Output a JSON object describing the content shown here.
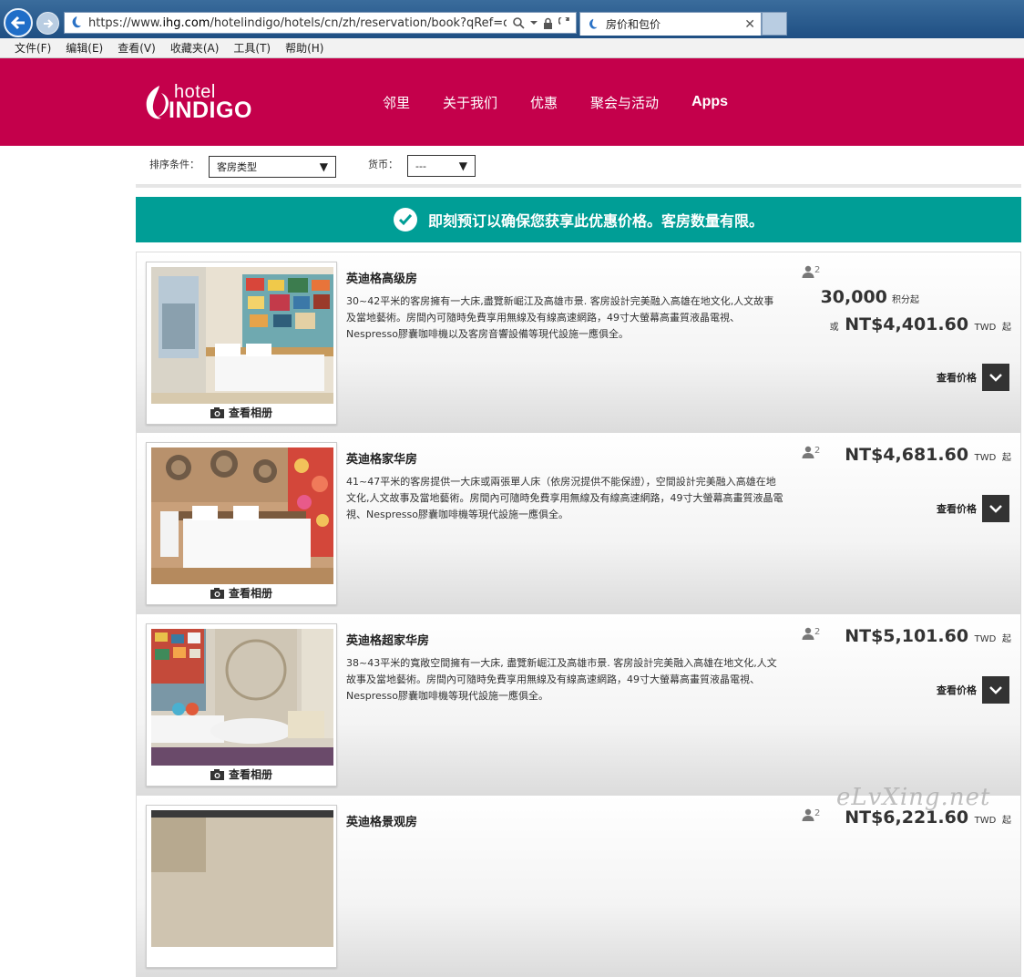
{
  "browser": {
    "url_prefix": "https://www.",
    "url_domain": "ihg.com",
    "url_rest": "/hotelindigo/hotels/cn/zh/reservation/book?qRef=df&qRpn",
    "tab_title": "房价和包价",
    "menu": [
      "文件(F)",
      "编辑(E)",
      "查看(V)",
      "收藏夹(A)",
      "工具(T)",
      "帮助(H)"
    ]
  },
  "header": {
    "logo_hotel": "hotel",
    "logo_indigo": "INDIGO",
    "nav": [
      "邻里",
      "关于我们",
      "优惠",
      "聚会与活动",
      "Apps"
    ]
  },
  "filters": {
    "sort_label": "排序条件：",
    "sort_value": "客房类型",
    "currency_label": "货币：",
    "currency_value": "---"
  },
  "promo": {
    "text": "即刻预订以确保您获享此优惠价格。客房数量有限。"
  },
  "album_label": "查看相册",
  "view_price_label": "查看价格",
  "or_label": "或",
  "from_label": "起",
  "points_suffix": "积分起",
  "currency_code": "TWD",
  "rooms": [
    {
      "title": "英迪格高级房",
      "desc": "30~42平米的客房擁有一大床,盡覽新崛江及高雄市景. 客房設計完美融入高雄在地文化,人文故事及當地藝術。房間內可隨時免費享用無線及有線高速網路，49寸大螢幕高畫質液晶電視、Nespresso膠囊咖啡機以及客房音響設備等現代設施一應俱全。",
      "occupancy": "2",
      "points": "30,000",
      "price": "NT$4,401.60"
    },
    {
      "title": "英迪格家华房",
      "desc": "41~47平米的客房提供一大床或兩張單人床（依房況提供不能保證），空間設計完美融入高雄在地文化,人文故事及當地藝術。房間內可隨時免費享用無線及有線高速網路，49寸大螢幕高畫質液晶電視、Nespresso膠囊咖啡機等現代設施一應俱全。",
      "occupancy": "2",
      "price": "NT$4,681.60"
    },
    {
      "title": "英迪格超家华房",
      "desc": "38~43平米的寬敞空間擁有一大床, 盡覽新崛江及高雄市景. 客房設計完美融入高雄在地文化,人文故事及當地藝術。房間內可隨時免費享用無線及有線高速網路，49寸大螢幕高畫質液晶電視、Nespresso膠囊咖啡機等現代設施一應俱全。",
      "occupancy": "2",
      "price": "NT$5,101.60"
    },
    {
      "title": "英迪格景观房",
      "occupancy": "2",
      "price": "NT$6,221.60"
    }
  ],
  "watermark": "eLvXing.net",
  "colors": {
    "brand": "#c4004b",
    "promo": "#009e96",
    "nav_dark": "#333333"
  }
}
